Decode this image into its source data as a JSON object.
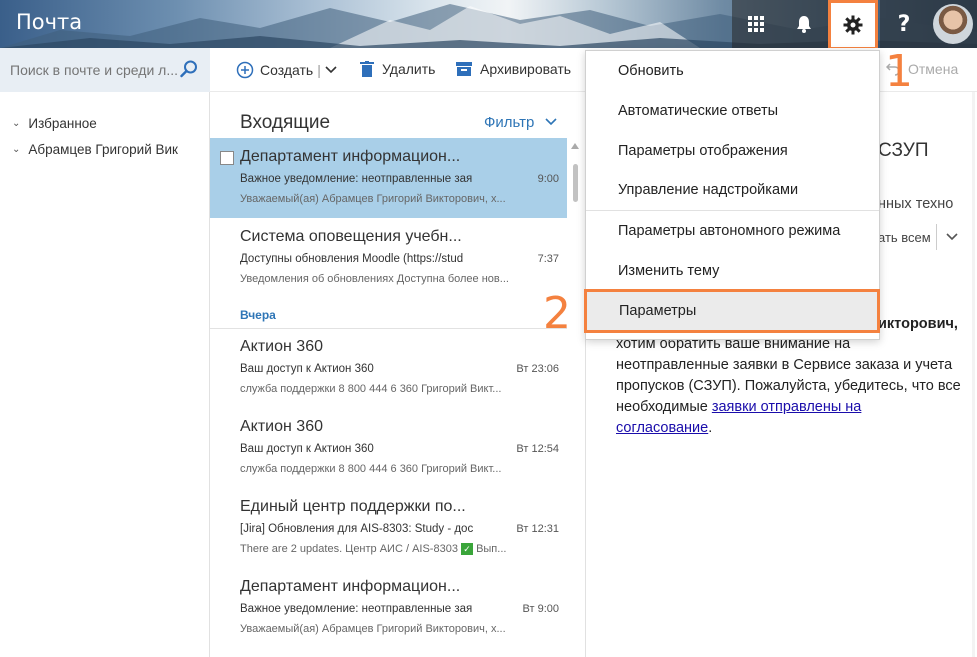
{
  "header": {
    "app_title": "Почта",
    "icons": {
      "apps": "app-grid-icon",
      "notifications": "bell-icon",
      "settings": "gear-icon",
      "help": "help-icon"
    },
    "help_label": "?"
  },
  "search": {
    "placeholder": "Поиск в почте и среди л..."
  },
  "folders": [
    {
      "label": "Избранное"
    },
    {
      "label": "Абрамцев Григорий Вик"
    }
  ],
  "commands": {
    "create": "Создать",
    "delete": "Удалить",
    "archive": "Архивировать",
    "undo": "Отмена"
  },
  "list": {
    "title": "Входящие",
    "filter": "Фильтр",
    "day_separator": "Вчера",
    "messages": [
      {
        "from": "Департамент информацион...",
        "subject": "Важное уведомление: неотправленные зая",
        "time": "9:00",
        "preview": "Уважаемый(ая) Абрамцев Григорий Викторович, х..."
      },
      {
        "from": "Система оповещения учебн...",
        "subject": "Доступны обновления Moodle (https://stud",
        "time": "7:37",
        "preview": "Уведомления об обновлениях Доступна более нов..."
      },
      {
        "from": "Актион 360",
        "subject": "Ваш доступ к Актион 360",
        "time": "Вт 23:06",
        "preview": "служба поддержки 8 800 444 6 360 Григорий Викт..."
      },
      {
        "from": "Актион 360",
        "subject": "Ваш доступ к Актион 360",
        "time": "Вт 12:54",
        "preview": "служба поддержки 8 800 444 6 360 Григорий Викт..."
      },
      {
        "from": "Единый центр поддержки по...",
        "subject": "[Jira] Обновления для AIS-8303: Study - дос",
        "time": "Вт 12:31",
        "preview": "There are 2 updates. Центр АИС / AIS-8303",
        "preview_tail": "Вып..."
      },
      {
        "from": "Департамент информацион...",
        "subject": "Важное уведомление: неотправленные зая",
        "time": "Вт 9:00",
        "preview": "Уважаемый(ая) Абрамцев Григорий Викторович, х..."
      }
    ]
  },
  "menu": {
    "items": [
      {
        "label": "Обновить"
      },
      {
        "label": "Автоматические ответы"
      },
      {
        "label": "Параметры отображения"
      },
      {
        "label": "Управление надстройками"
      },
      {
        "label": "Параметры автономного режима"
      },
      {
        "label": "Изменить тему"
      },
      {
        "label": "Параметры"
      }
    ]
  },
  "reading": {
    "title_fragment": "СЗУП",
    "tech_fragment": "нных техно",
    "reply_all_fragment": "ать всем",
    "name_fragment": "икторович,",
    "body_line1": "хотим обратить ваше внимание на",
    "body_line2": "неотправленные заявки в Сервисе заказа и учета",
    "body_line3": "пропусков (СЗУП). Пожалуйста, убедитесь, что все",
    "body_line4_pre": "необходимые ",
    "link_part1": "заявки отправлены на",
    "link_part2": "согласование",
    "body_end": "."
  },
  "annotations": {
    "step1": "1",
    "step2": "2"
  },
  "colors": {
    "accent": "#f4813f",
    "selected": "#a9cfe8",
    "link": "#2e75b6"
  }
}
